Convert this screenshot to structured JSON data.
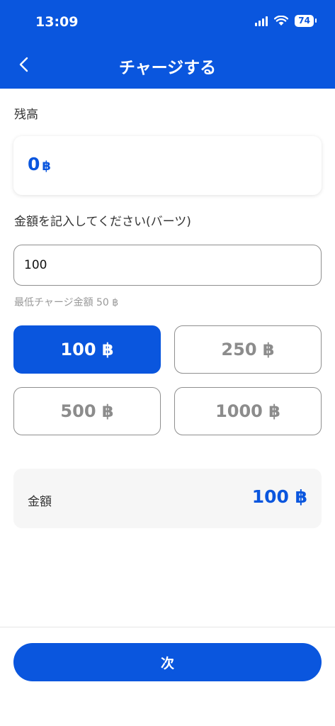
{
  "status_bar": {
    "time": "13:09",
    "battery": "74"
  },
  "header": {
    "title": "チャージする",
    "back_icon": "chevron-left-icon"
  },
  "balance": {
    "label": "残高",
    "value": "0",
    "unit": "฿"
  },
  "amount_input": {
    "label": "金額を記入してください(バーツ)",
    "value": "100",
    "hint": "最低チャージ金額 50 ฿"
  },
  "presets": [
    {
      "label": "100 ฿",
      "selected": true
    },
    {
      "label": "250 ฿",
      "selected": false
    },
    {
      "label": "500 ฿",
      "selected": false
    },
    {
      "label": "1000 ฿",
      "selected": false
    }
  ],
  "summary": {
    "label": "金額",
    "value": "100 ฿"
  },
  "footer": {
    "next_label": "次"
  },
  "colors": {
    "primary": "#0a56de",
    "muted": "#8c8c8c",
    "card": "#f6f6f6"
  }
}
